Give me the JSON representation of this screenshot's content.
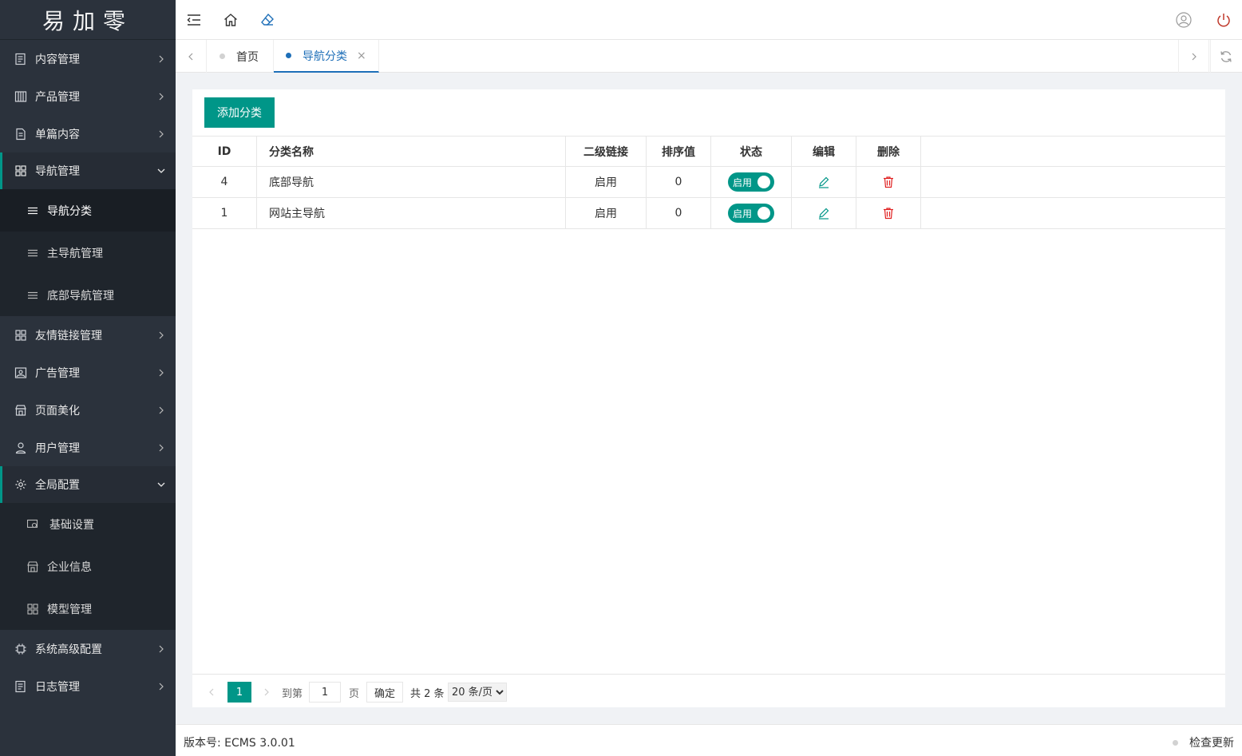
{
  "app": {
    "logo_text": "易加零"
  },
  "sidebar": {
    "items": [
      {
        "label": "内容管理",
        "icon": "document-list-icon"
      },
      {
        "label": "产品管理",
        "icon": "product-grid-icon"
      },
      {
        "label": "单篇内容",
        "icon": "page-icon"
      },
      {
        "label": "导航管理",
        "icon": "apps-grid-icon",
        "open": true,
        "children": [
          {
            "label": "导航分类",
            "icon": "list-lines-icon",
            "active": true
          },
          {
            "label": "主导航管理",
            "icon": "list-lines-icon"
          },
          {
            "label": "底部导航管理",
            "icon": "list-lines-icon"
          }
        ]
      },
      {
        "label": "友情链接管理",
        "icon": "apps-grid-icon"
      },
      {
        "label": "广告管理",
        "icon": "picture-icon"
      },
      {
        "label": "页面美化",
        "icon": "store-icon"
      },
      {
        "label": "用户管理",
        "icon": "user-icon"
      },
      {
        "label": "全局配置",
        "icon": "gear-icon",
        "open": true,
        "children": [
          {
            "label": "基础设置",
            "icon": "settings-screen-icon"
          },
          {
            "label": "企业信息",
            "icon": "store-icon"
          },
          {
            "label": "模型管理",
            "icon": "apps-grid-icon"
          }
        ]
      },
      {
        "label": "系统高级配置",
        "icon": "chip-icon"
      },
      {
        "label": "日志管理",
        "icon": "document-list-icon"
      }
    ]
  },
  "tabs": [
    {
      "label": "首页",
      "active": false
    },
    {
      "label": "导航分类",
      "active": true,
      "close": "×"
    }
  ],
  "toolbar": {
    "add_label": "添加分类"
  },
  "table": {
    "headers": [
      "ID",
      "分类名称",
      "二级链接",
      "排序值",
      "状态",
      "编辑",
      "删除"
    ],
    "rows": [
      {
        "id": "4",
        "name": "底部导航",
        "link": "启用",
        "sort": "0",
        "status": "启用"
      },
      {
        "id": "1",
        "name": "网站主导航",
        "link": "启用",
        "sort": "0",
        "status": "启用"
      }
    ]
  },
  "pager": {
    "current": "1",
    "goto_label": "到第",
    "page_value": "1",
    "page_unit": "页",
    "confirm_label": "确定",
    "total_label": "共 2 条",
    "page_size": "20 条/页"
  },
  "footer": {
    "version": "版本号: ECMS 3.0.01",
    "update_label": "检查更新"
  },
  "colors": {
    "sidebar_bg": "#2b323c",
    "accent": "#009688",
    "tab_active": "#1e6fb8",
    "delete": "#e02020"
  }
}
